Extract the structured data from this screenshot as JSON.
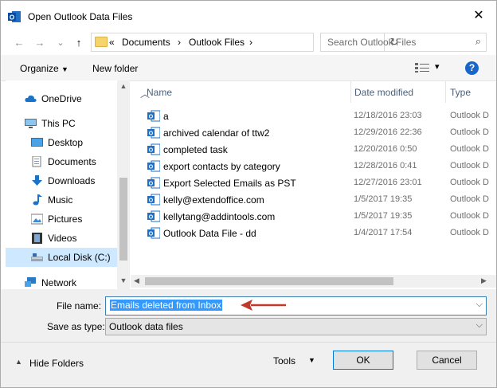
{
  "window": {
    "title": "Open Outlook Data Files",
    "close": "✕"
  },
  "nav": {
    "back": "←",
    "forward": "→",
    "recent": "⌄",
    "up": "↑",
    "breadcrumb": [
      "«",
      "Documents",
      "›",
      "Outlook Files",
      "›"
    ],
    "refresh": "↻",
    "search_placeholder": "Search Outlook Files",
    "search_icon": "search-icon"
  },
  "toolbar": {
    "organize": "Organize",
    "new_folder": "New folder",
    "help": "?",
    "view_dd": "▾"
  },
  "sidebar": {
    "items": [
      {
        "label": "OneDrive",
        "icon": "cloud-icon"
      },
      {
        "label": "This PC",
        "icon": "computer-icon"
      },
      {
        "label": "Desktop",
        "icon": "desktop-icon"
      },
      {
        "label": "Documents",
        "icon": "documents-icon"
      },
      {
        "label": "Downloads",
        "icon": "download-icon"
      },
      {
        "label": "Music",
        "icon": "music-icon"
      },
      {
        "label": "Pictures",
        "icon": "pictures-icon"
      },
      {
        "label": "Videos",
        "icon": "videos-icon"
      },
      {
        "label": "Local Disk (C:)",
        "icon": "disk-icon"
      },
      {
        "label": "Network",
        "icon": "network-icon"
      }
    ]
  },
  "columns": {
    "name": "Name",
    "date": "Date modified",
    "type": "Type"
  },
  "files": [
    {
      "name": "a",
      "date": "12/18/2016 23:03",
      "type": "Outlook D"
    },
    {
      "name": "archived calendar of ttw2",
      "date": "12/29/2016 22:36",
      "type": "Outlook D"
    },
    {
      "name": "completed task",
      "date": "12/20/2016 0:50",
      "type": "Outlook D"
    },
    {
      "name": "export contacts by category",
      "date": "12/28/2016 0:41",
      "type": "Outlook D"
    },
    {
      "name": "Export Selected Emails as PST",
      "date": "12/27/2016 23:01",
      "type": "Outlook D"
    },
    {
      "name": "kelly@extendoffice.com",
      "date": "1/5/2017 19:35",
      "type": "Outlook D"
    },
    {
      "name": "kellytang@addintools.com",
      "date": "1/5/2017 19:35",
      "type": "Outlook D"
    },
    {
      "name": "Outlook Data File - dd",
      "date": "1/4/2017 17:54",
      "type": "Outlook D"
    }
  ],
  "form": {
    "file_name_label": "File name:",
    "file_name_value": "Emails deleted from Inbox",
    "save_as_label": "Save as type:",
    "save_as_value": "Outlook data files"
  },
  "footer": {
    "hide_folders": "Hide Folders",
    "tools": "Tools",
    "ok": "OK",
    "cancel": "Cancel"
  },
  "colors": {
    "accent": "#0078d7",
    "selection": "#cde8ff",
    "annotation_arrow": "#c0392b"
  }
}
